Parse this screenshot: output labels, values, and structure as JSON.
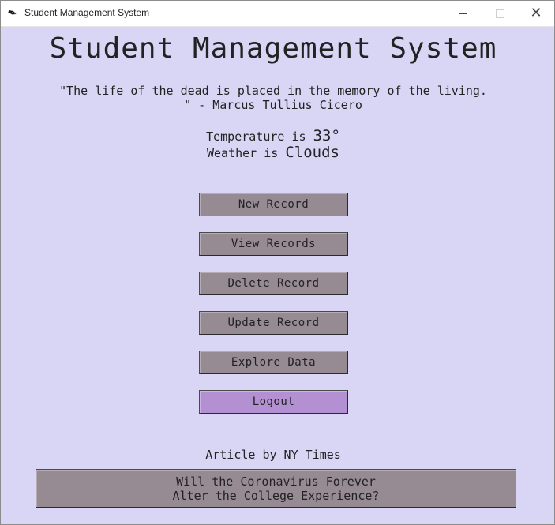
{
  "window": {
    "title": "Student Management System",
    "icon": "feather-icon"
  },
  "header": {
    "title": "Student Management System"
  },
  "quote": {
    "text": "\"The life of the dead is placed in the memory of the living.\n\" - Marcus Tullius Cicero"
  },
  "weather": {
    "temperature_prefix": "Temperature is ",
    "temperature_value": "33°",
    "weather_prefix": "Weather is ",
    "weather_value": "Clouds"
  },
  "menu": {
    "new_record": "New Record",
    "view_records": "View Records",
    "delete_record": "Delete Record",
    "update_record": "Update Record",
    "explore_data": "Explore Data",
    "logout": "Logout"
  },
  "article": {
    "label": "Article by NY Times",
    "headline": "Will the Coronavirus Forever\nAlter the College Experience?"
  },
  "colors": {
    "background": "#d9d5f5",
    "button": "#968a93",
    "logout_button": "#b390d2"
  }
}
